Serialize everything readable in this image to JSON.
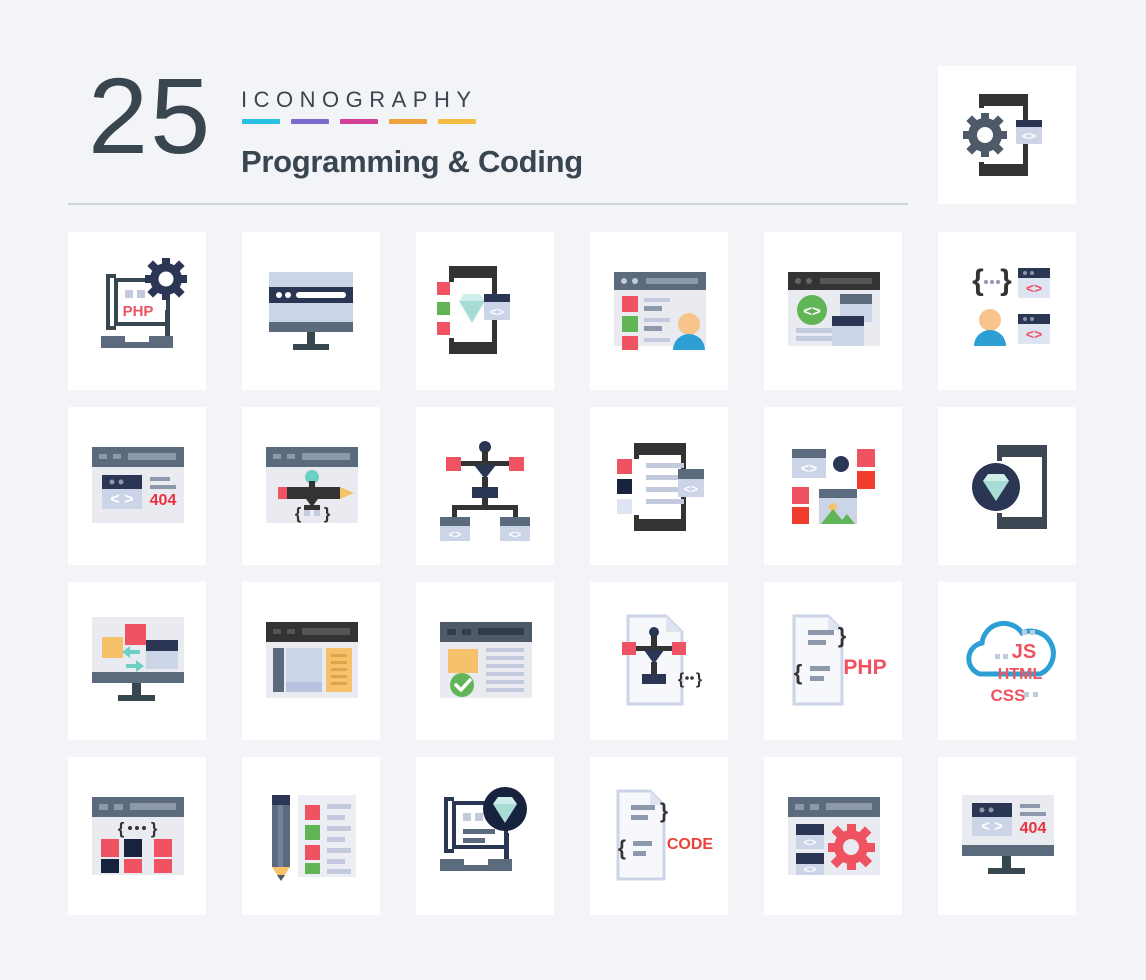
{
  "header": {
    "count": "25",
    "eyebrow": "ICONOGRAPHY",
    "title": "Programming & Coding",
    "swatch_colors": [
      "#29bfe0",
      "#7b6bcf",
      "#d23f96",
      "#f0a03c",
      "#f5bd42"
    ],
    "divider_color": "#ccd4de",
    "feature_icon": {
      "name": "mobile-gear-code-icon",
      "label": "Mobile Development Settings"
    }
  },
  "theme": {
    "background": "#f3f4f8",
    "card_background": "#ffffff",
    "ink": "#39454f",
    "dark": "#333333",
    "slate": "#5b6a7d",
    "lavender": "#c3cade",
    "pale": "#e9ebf0",
    "red": "#ef5261",
    "green": "#62b557",
    "teal": "#a8ddd6",
    "navy": "#2b3655",
    "amber": "#f5c26b",
    "blue": "#2e9fd4",
    "skin": "#f7c48b"
  },
  "grid": {
    "columns": 6,
    "rows": 4,
    "total_icons": 24,
    "icons": [
      {
        "row": 1,
        "col": 1,
        "name": "php-laptop-gear-icon",
        "label": "PHP Development",
        "text": "PHP"
      },
      {
        "row": 1,
        "col": 2,
        "name": "monitor-browser-icon",
        "label": "Desktop Browser"
      },
      {
        "row": 1,
        "col": 3,
        "name": "mobile-diamond-code-icon",
        "label": "Mobile Premium Code"
      },
      {
        "row": 1,
        "col": 4,
        "name": "browser-user-list-icon",
        "label": "User Profile Listing"
      },
      {
        "row": 1,
        "col": 5,
        "name": "browser-code-layout-icon",
        "label": "Web Layout Code"
      },
      {
        "row": 1,
        "col": 6,
        "name": "brackets-user-code-windows-icon",
        "label": "Developer Team Code"
      },
      {
        "row": 2,
        "col": 1,
        "name": "browser-404-icon",
        "label": "Page Not Found",
        "text": "404"
      },
      {
        "row": 2,
        "col": 2,
        "name": "browser-pen-design-icon",
        "label": "Web Design Tool"
      },
      {
        "row": 2,
        "col": 3,
        "name": "sitemap-hierarchy-icon",
        "label": "Site Structure"
      },
      {
        "row": 2,
        "col": 4,
        "name": "mobile-content-list-icon",
        "label": "Mobile Content"
      },
      {
        "row": 2,
        "col": 5,
        "name": "modular-components-icon",
        "label": "Component Library"
      },
      {
        "row": 2,
        "col": 6,
        "name": "mobile-diamond-badge-icon",
        "label": "Premium Mobile App"
      },
      {
        "row": 3,
        "col": 1,
        "name": "monitor-drag-drop-icon",
        "label": "Drag and Drop Builder"
      },
      {
        "row": 3,
        "col": 2,
        "name": "browser-sidebar-layout-icon",
        "label": "Sidebar Layout"
      },
      {
        "row": 3,
        "col": 3,
        "name": "browser-validation-check-icon",
        "label": "Validated Page"
      },
      {
        "row": 3,
        "col": 4,
        "name": "file-node-diagram-icon",
        "label": "Code Structure File"
      },
      {
        "row": 3,
        "col": 5,
        "name": "php-file-icon",
        "label": "PHP File",
        "text": "PHP"
      },
      {
        "row": 3,
        "col": 6,
        "name": "cloud-languages-icon",
        "label": "Cloud Web Languages",
        "text_js": "JS",
        "text_html": "HTML",
        "text_css": "CSS"
      },
      {
        "row": 4,
        "col": 1,
        "name": "browser-code-grid-icon",
        "label": "Code Modules Grid"
      },
      {
        "row": 4,
        "col": 2,
        "name": "pencil-checklist-icon",
        "label": "Design Checklist"
      },
      {
        "row": 4,
        "col": 3,
        "name": "laptop-diamond-icon",
        "label": "Premium Desktop"
      },
      {
        "row": 4,
        "col": 4,
        "name": "code-file-icon",
        "label": "Code File",
        "text": "CODE"
      },
      {
        "row": 4,
        "col": 5,
        "name": "browser-settings-gear-icon",
        "label": "Web Configuration"
      },
      {
        "row": 4,
        "col": 6,
        "name": "monitor-404-icon",
        "label": "Desktop Error 404",
        "text": "404"
      }
    ]
  }
}
